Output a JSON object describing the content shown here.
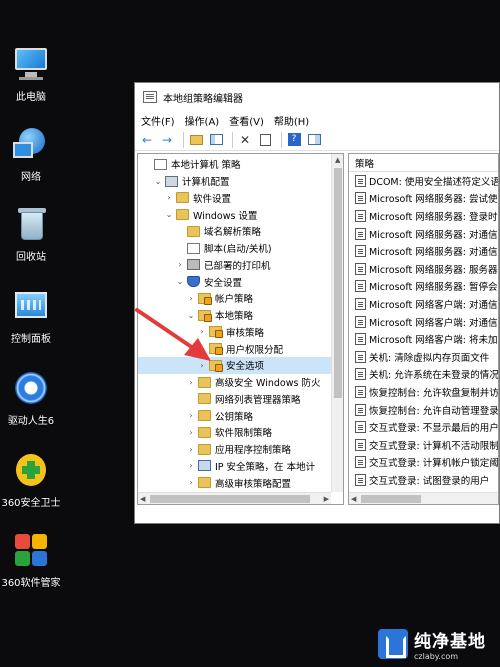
{
  "desktop": {
    "icons": [
      {
        "label": "此电脑",
        "icon": "pc-icon"
      },
      {
        "label": "网络",
        "icon": "network-icon"
      },
      {
        "label": "回收站",
        "icon": "recycle-bin-icon"
      },
      {
        "label": "控制面板",
        "icon": "control-panel-icon"
      },
      {
        "label": "驱动人生6",
        "icon": "driver-life-icon"
      },
      {
        "label": "360安全卫士",
        "icon": "360-security-icon"
      },
      {
        "label": "360软件管家",
        "icon": "360-software-icon"
      }
    ]
  },
  "window": {
    "title": "本地组策略编辑器",
    "menu": [
      "文件(F)",
      "操作(A)",
      "查看(V)",
      "帮助(H)"
    ],
    "toolbar_icons": [
      "back-arrow-icon",
      "forward-arrow-icon",
      "up-folder-icon",
      "show-hide-tree-icon",
      "delete-icon",
      "export-icon",
      "help-icon",
      "properties-icon"
    ]
  },
  "tree": {
    "rows": [
      {
        "label": "本地计算机 策略",
        "indent": 0,
        "arrow": "",
        "icon": "doc"
      },
      {
        "label": "计算机配置",
        "indent": 1,
        "arrow": "⌄",
        "icon": "computer"
      },
      {
        "label": "软件设置",
        "indent": 2,
        "arrow": "›",
        "icon": "folder"
      },
      {
        "label": "Windows 设置",
        "indent": 2,
        "arrow": "⌄",
        "icon": "folder"
      },
      {
        "label": "域名解析策略",
        "indent": 3,
        "arrow": "",
        "icon": "folder"
      },
      {
        "label": "脚本(启动/关机)",
        "indent": 3,
        "arrow": "",
        "icon": "doc"
      },
      {
        "label": "已部署的打印机",
        "indent": 3,
        "arrow": "›",
        "icon": "printer"
      },
      {
        "label": "安全设置",
        "indent": 3,
        "arrow": "⌄",
        "icon": "shield"
      },
      {
        "label": "帐户策略",
        "indent": 4,
        "arrow": "›",
        "icon": "folder-lock"
      },
      {
        "label": "本地策略",
        "indent": 4,
        "arrow": "⌄",
        "icon": "folder-lock"
      },
      {
        "label": "审核策略",
        "indent": 5,
        "arrow": "›",
        "icon": "folder-lock"
      },
      {
        "label": "用户权限分配",
        "indent": 5,
        "arrow": "›",
        "icon": "folder-lock"
      },
      {
        "label": "安全选项",
        "indent": 5,
        "arrow": "›",
        "icon": "folder-lock",
        "selected": true
      },
      {
        "label": "高级安全 Windows 防火",
        "indent": 4,
        "arrow": "›",
        "icon": "folder"
      },
      {
        "label": "网络列表管理器策略",
        "indent": 4,
        "arrow": "",
        "icon": "folder"
      },
      {
        "label": "公钥策略",
        "indent": 4,
        "arrow": "›",
        "icon": "folder"
      },
      {
        "label": "软件限制策略",
        "indent": 4,
        "arrow": "›",
        "icon": "folder"
      },
      {
        "label": "应用程序控制策略",
        "indent": 4,
        "arrow": "›",
        "icon": "folder"
      },
      {
        "label": "IP 安全策略，在 本地计",
        "indent": 4,
        "arrow": "›",
        "icon": "ip"
      },
      {
        "label": "高级审核策略配置",
        "indent": 4,
        "arrow": "›",
        "icon": "folder"
      }
    ]
  },
  "list": {
    "header": "策略",
    "rows": [
      "DCOM: 使用安全描述符定义语",
      "Microsoft 网络服务器: 尝试使",
      "Microsoft 网络服务器: 登录时",
      "Microsoft 网络服务器: 对通信",
      "Microsoft 网络服务器: 对通信",
      "Microsoft 网络服务器: 服务器",
      "Microsoft 网络服务器: 暂停会",
      "Microsoft 网络客户端: 对通信",
      "Microsoft 网络客户端: 对通信",
      "Microsoft 网络客户端: 将未加",
      "关机: 清除虚拟内存页面文件",
      "关机: 允许系统在未登录的情况",
      "恢复控制台: 允许软盘复制并访",
      "恢复控制台: 允许自动管理登录",
      "交互式登录: 不显示最后的用户",
      "交互式登录: 计算机不活动限制",
      "交互式登录: 计算机帐户锁定阈",
      "交互式登录: 试图登录的用户"
    ]
  },
  "watermark": {
    "brand": "纯净基地",
    "domain": "czlaby.com"
  },
  "colors": {
    "desktop_bg": "#0b0b0d",
    "selection": "#cce4f7",
    "arrow_red": "#e33a3a",
    "watermark_blue": "#2b74d8"
  }
}
